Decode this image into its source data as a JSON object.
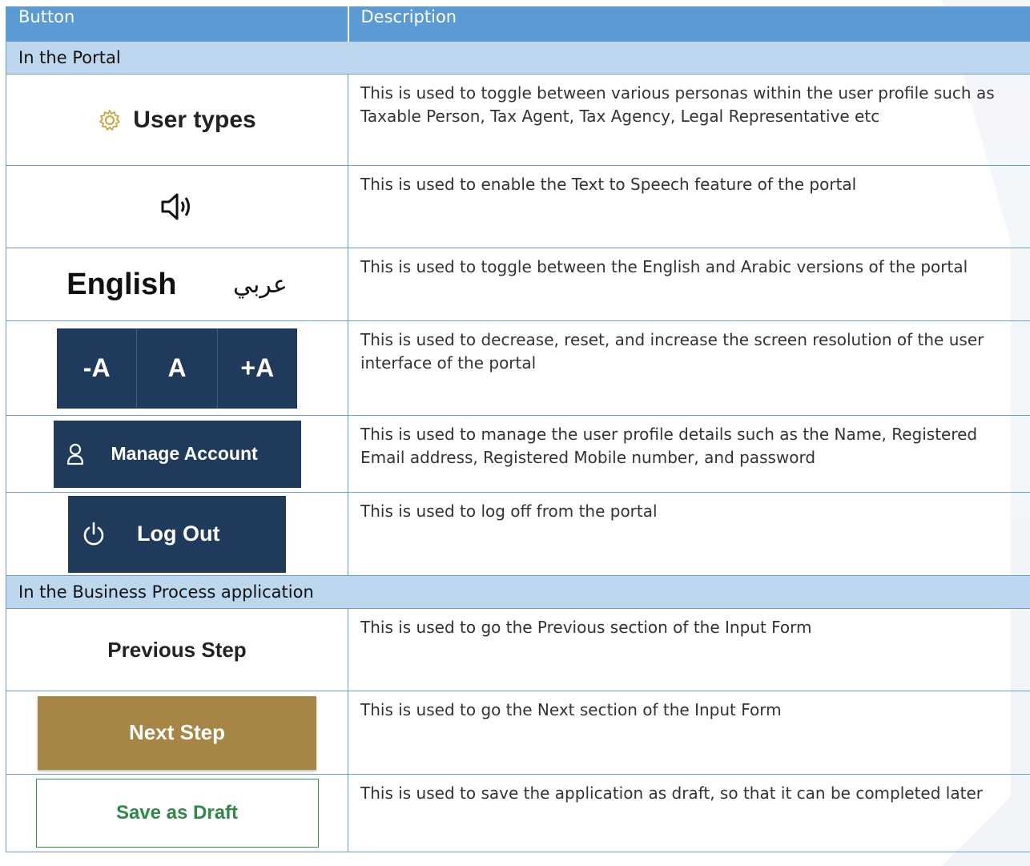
{
  "header": {
    "col1": "Button",
    "col2": "Description"
  },
  "sections": [
    {
      "title": "In the Portal"
    },
    {
      "title": "In the Business Process application"
    }
  ],
  "rows": {
    "user_types": {
      "label": "User types",
      "icon": "gear-icon",
      "desc": "This is used to toggle between various personas within the user profile such as Taxable Person, Tax Agent, Tax Agency, Legal Representative etc"
    },
    "speech": {
      "glyph": "🔉︎",
      "icon": "speaker-icon",
      "desc": "This is used to enable the Text to Speech feature of the portal"
    },
    "language": {
      "english": "English",
      "arabic": "عربي",
      "desc": "This is used to toggle between the English and Arabic versions of the portal"
    },
    "font_size": {
      "decrease": "-A",
      "reset": "A",
      "increase": "+A",
      "desc": "This is used to decrease, reset, and increase the screen resolution of the user interface of the portal"
    },
    "manage_account": {
      "label": "Manage Account",
      "icon": "user-icon",
      "desc": "This is used to manage the user profile details such as the Name, Registered Email address, Registered Mobile number, and password"
    },
    "log_out": {
      "label": "Log Out",
      "icon": "power-icon",
      "desc": "This is used to log off from the portal"
    },
    "previous_step": {
      "label": "Previous Step",
      "desc": "This is used to go the Previous section of the Input Form"
    },
    "next_step": {
      "label": "Next Step",
      "desc": "This is used to go the Next section of the Input Form"
    },
    "save_draft": {
      "label": "Save as Draft",
      "desc": "This is used to save the application as draft, so that it can be completed later"
    }
  },
  "colors": {
    "header": "#5b9bd5",
    "section": "#bdd7ee",
    "dark_button": "#1f3a5a",
    "next_button": "#a78544",
    "draft_border": "#2e9a4e"
  }
}
